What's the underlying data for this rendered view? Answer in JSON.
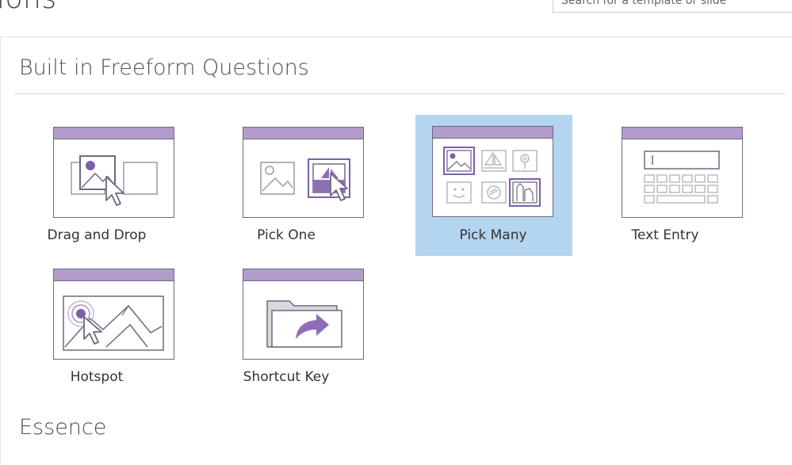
{
  "header": {
    "title_fragment": "ions",
    "search_placeholder": "Search for a template or slide"
  },
  "sections": [
    {
      "title": "Built in Freeform Questions",
      "items": [
        {
          "label": "Drag and Drop",
          "selected": false
        },
        {
          "label": "Pick One",
          "selected": false
        },
        {
          "label": "Pick Many",
          "selected": true
        },
        {
          "label": "Text Entry",
          "selected": false
        },
        {
          "label": "Hotspot",
          "selected": false
        },
        {
          "label": "Shortcut Key",
          "selected": false
        }
      ]
    },
    {
      "title": "Essence"
    }
  ],
  "colors": {
    "accent_bar": "#b39bcb",
    "selection": "#b4d5ef",
    "outline": "#6b6b80"
  }
}
